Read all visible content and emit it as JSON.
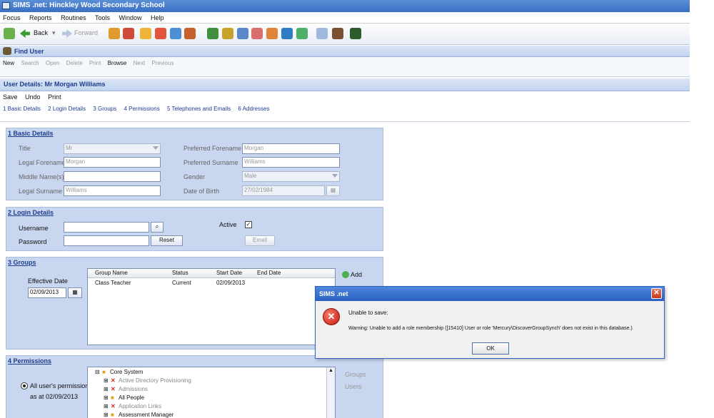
{
  "window": {
    "title": "SIMS .net: Hinckley Wood Secondary School"
  },
  "menu": [
    "Focus",
    "Reports",
    "Routines",
    "Tools",
    "Window",
    "Help"
  ],
  "nav": {
    "back_label": "Back",
    "forward_label": "Forward"
  },
  "find_user": {
    "title": "Find User",
    "toolbar": [
      "New",
      "Search",
      "Open",
      "Delete",
      "Print",
      "Browse",
      "Next",
      "Previous"
    ]
  },
  "user_details": {
    "title": "User Details: Mr Morgan Williams",
    "toolbar": [
      "Save",
      "Undo",
      "Print"
    ],
    "links": [
      "1 Basic Details",
      "2 Login Details",
      "3 Groups",
      "4 Permissions",
      "5 Telephones and Emails",
      "6 Addresses"
    ]
  },
  "basic": {
    "title": "1 Basic Details",
    "title_label": "Title",
    "title_value": "Mr",
    "legal_forename_label": "Legal Forename",
    "legal_forename": "Morgan",
    "middle_label": "Middle Name(s)",
    "middle": "",
    "legal_surname_label": "Legal Surname",
    "legal_surname": "Williams",
    "pref_forename_label": "Preferred Forename",
    "pref_forename": "Morgan",
    "pref_surname_label": "Preferred Surname",
    "pref_surname": "Williams",
    "gender_label": "Gender",
    "gender": "Male",
    "dob_label": "Date of Birth",
    "dob": "27/02/1984"
  },
  "login": {
    "title": "2 Login Details",
    "username_label": "Username",
    "username": "",
    "password_label": "Password",
    "password": "",
    "reset_label": "Reset",
    "active_label": "Active",
    "email_label": "Email"
  },
  "groups": {
    "title": "3 Groups",
    "effective_date_label": "Effective Date",
    "effective_date": "02/09/2013",
    "add_label": "Add",
    "columns": [
      "Group Name",
      "Status",
      "Start Date",
      "End Date"
    ],
    "rows": [
      {
        "name": "Class Teacher",
        "status": "Current",
        "start": "02/09/2013",
        "end": ""
      }
    ]
  },
  "permissions": {
    "title": "4 Permissions",
    "option_label": "All user's permissions",
    "as_at": "as at 02/09/2013",
    "tree": [
      "Core System",
      "Active Directory Provisioning",
      "Admissions",
      "All People",
      "Application Links",
      "Assessment Manager"
    ],
    "groups_btn": "Groups",
    "users_btn": "Users"
  },
  "dialog": {
    "title": "SIMS .net",
    "message1": "Unable to save:",
    "message2": "Warning: Unable to add a role membership ([15410] User or role 'Mercury\\DiscoverGroupSynch' does not exist in this database.)",
    "ok_label": "OK"
  },
  "colors": {
    "accent": "#2a5fc0",
    "section_bg": "#c9d6f0",
    "error": "#c41a0c"
  }
}
